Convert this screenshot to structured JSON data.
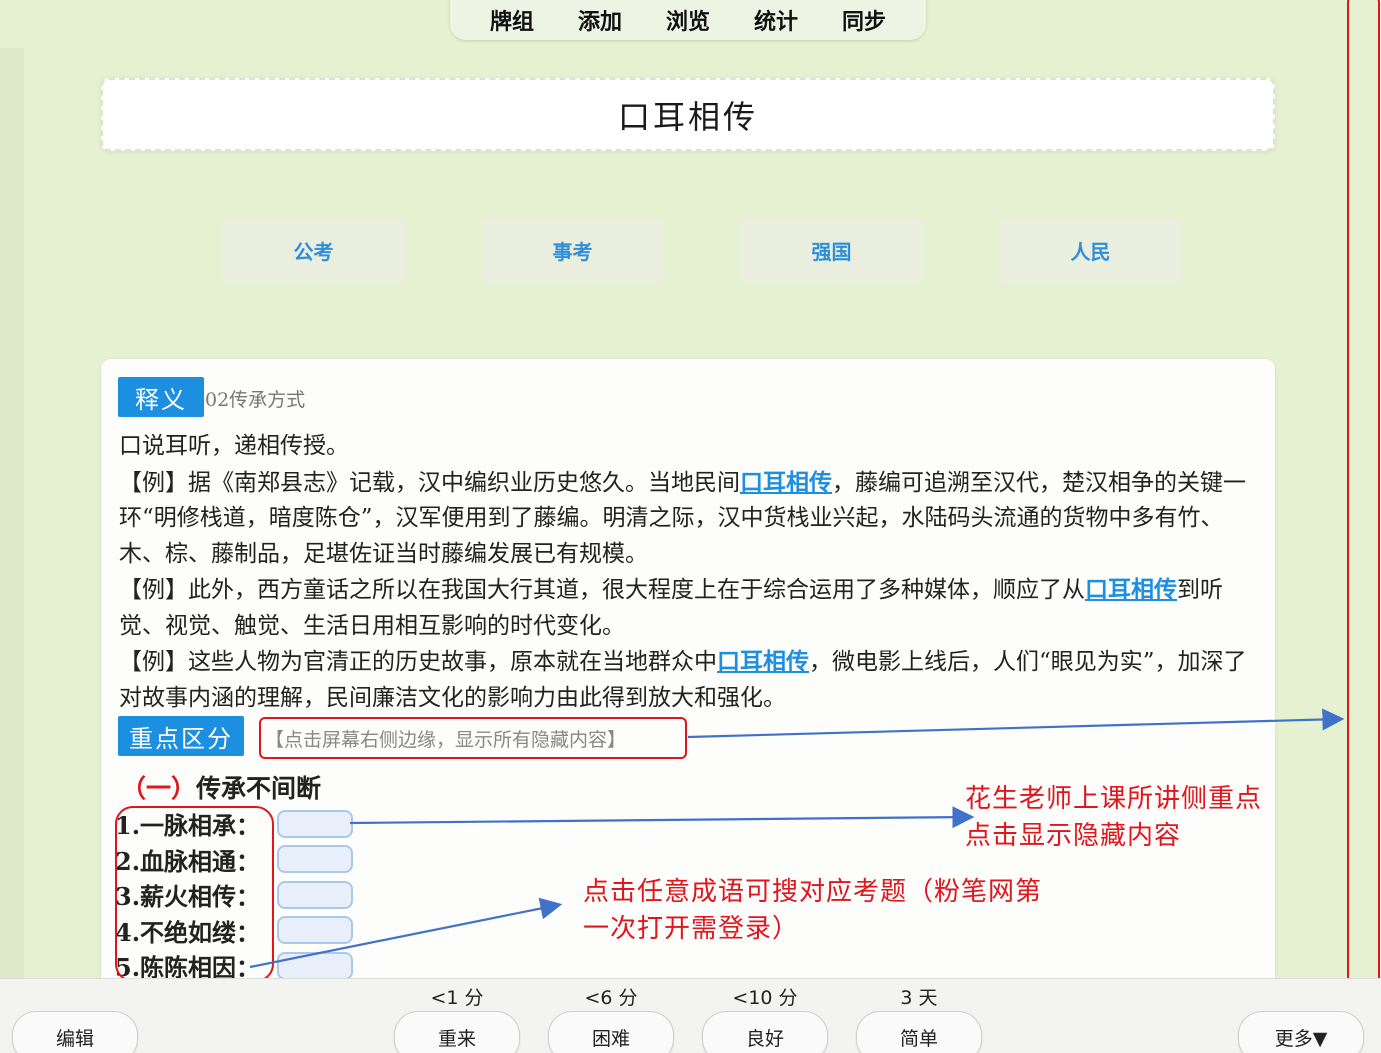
{
  "top_menu": [
    "牌组",
    "添加",
    "浏览",
    "统计",
    "同步"
  ],
  "card": {
    "title": "口耳相传",
    "categories": [
      "公考",
      "事考",
      "强国",
      "人民"
    ],
    "meaning_tag": "释义",
    "meaning_sub": "02传承方式",
    "definition": "口说耳听，递相传授。",
    "examples": [
      {
        "before": "【例】据《南郑县志》记载，汉中编织业历史悠久。当地民间",
        "highlight": "口耳相传",
        "after": "，藤编可追溯至汉代，楚汉相争的关键一环“明修栈道，暗度陈仓”，汉军便用到了藤编。明清之际，汉中货栈业兴起，水陆码头流通的货物中多有竹、木、棕、藤制品，足堪佐证当时藤编发展已有规模。"
      },
      {
        "before": "【例】此外，西方童话之所以在我国大行其道，很大程度上在于综合运用了多种媒体，顺应了从",
        "highlight": "口耳相传",
        "after": "到听觉、视觉、触觉、生活日用相互影响的时代变化。"
      },
      {
        "before": "【例】这些人物为官清正的历史故事，原本就在当地群众中",
        "highlight": "口耳相传",
        "after": "，微电影上线后，人们“眼见为实”，加深了对故事内涵的理解，民间廉洁文化的影响力由此得到放大和强化。"
      }
    ],
    "key_tag": "重点区分",
    "hint": "【点击屏幕右侧边缘，显示所有隐藏内容】",
    "section_num": "（一）",
    "section_title": "传承不间断",
    "idioms": [
      "1.一脉相承：",
      "2.血脉相通：",
      "3.薪火相传：",
      "4.不绝如缕：",
      "5.陈陈相因："
    ]
  },
  "annotations": {
    "teacher_note_line1": "花生老师上课所讲侧重点",
    "teacher_note_line2": "点击显示隐藏内容",
    "search_note_line1": "点击任意成语可搜对应考题（粉笔网第",
    "search_note_line2": "一次打开需登录）"
  },
  "bottom_bar": {
    "edit": "编辑",
    "intervals": [
      "<1 分",
      "<6 分",
      "<10 分",
      "3 天"
    ],
    "answers": [
      "重来",
      "困难",
      "良好",
      "简单"
    ],
    "more": "更多▼"
  },
  "colors": {
    "background": "#e6f1d2",
    "accent_blue": "#1d8fe0",
    "annotation_red": "#e0161c",
    "arrow_blue": "#3f72c8"
  }
}
